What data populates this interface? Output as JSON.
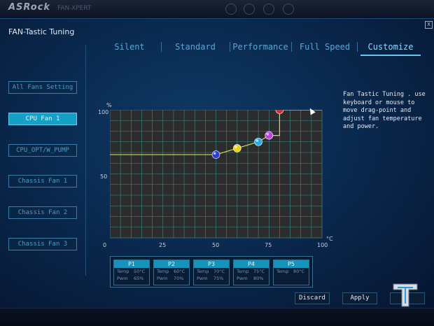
{
  "app": {
    "logo": "ASRock",
    "logo_sub": "FAN-XPERT"
  },
  "window": {
    "title": "FAN-Tastic Tuning",
    "close_label": "X"
  },
  "tabs": [
    {
      "label": "Silent",
      "active": false
    },
    {
      "label": "Standard",
      "active": false
    },
    {
      "label": "Performance",
      "active": false
    },
    {
      "label": "Full Speed",
      "active": false
    },
    {
      "label": "Customize",
      "active": true
    }
  ],
  "sidebar": {
    "items": [
      {
        "label": "All Fans Setting",
        "active": false
      },
      {
        "label": "CPU Fan 1",
        "active": true
      },
      {
        "label": "CPU_OPT/W_PUMP",
        "active": false
      },
      {
        "label": "Chassis Fan 1",
        "active": false
      },
      {
        "label": "Chassis Fan 2",
        "active": false
      },
      {
        "label": "Chassis Fan 3",
        "active": false
      }
    ]
  },
  "chart_data": {
    "type": "line",
    "ylabel": "%",
    "xlabel": "°C",
    "xlim": [
      0,
      100
    ],
    "ylim": [
      0,
      100
    ],
    "x_ticks": [
      "0",
      "25",
      "50",
      "75",
      "100"
    ],
    "y_ticks": [
      "100",
      "50"
    ],
    "grid": true,
    "baseline_start": [
      0,
      65
    ],
    "points": [
      {
        "name": "P1",
        "x": 50,
        "y": 65,
        "color": "#2f3fd6"
      },
      {
        "name": "P2",
        "x": 60,
        "y": 70,
        "color": "#e8d020"
      },
      {
        "name": "P3",
        "x": 70,
        "y": 75,
        "color": "#2aa8e8"
      },
      {
        "name": "P4",
        "x": 75,
        "y": 80,
        "color": "#c040e0"
      },
      {
        "name": "P5",
        "x": 80,
        "y": 100,
        "color": "#e02a2a"
      }
    ],
    "end": [
      100,
      100
    ],
    "line_color": "#c6e04a"
  },
  "description": "Fan Tastic Tuning . use keyboard or mouse to move drag-point and adjust fan temperature and power.",
  "points_panel": [
    {
      "name": "P1",
      "temp_label": "Temp",
      "temp": "50°C",
      "pwm_label": "Pwm",
      "pwm": "65%"
    },
    {
      "name": "P2",
      "temp_label": "Temp",
      "temp": "60°C",
      "pwm_label": "Pwm",
      "pwm": "70%"
    },
    {
      "name": "P3",
      "temp_label": "Temp",
      "temp": "70°C",
      "pwm_label": "Pwm",
      "pwm": "75%"
    },
    {
      "name": "P4",
      "temp_label": "Temp",
      "temp": "75°C",
      "pwm_label": "Pwm",
      "pwm": "80%"
    },
    {
      "name": "P5",
      "temp_label": "Temp",
      "temp": "80°C",
      "pwm_label": "",
      "pwm": ""
    }
  ],
  "actions": {
    "discard": "Discard",
    "apply": "Apply"
  }
}
